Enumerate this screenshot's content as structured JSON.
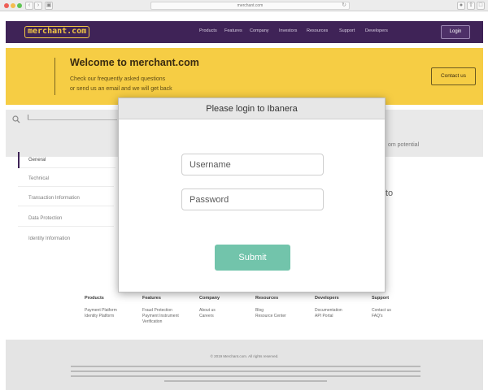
{
  "browser": {
    "url": "merchant.com",
    "back_glyph": "‹",
    "forward_glyph": "›",
    "sidebar_glyph": "▣",
    "reload_glyph": "↻",
    "right_icons": [
      "●",
      "⇧",
      "□"
    ]
  },
  "header": {
    "logo": "merchant.com",
    "nav": [
      "Products",
      "Features",
      "Company",
      "Investors",
      "Resources",
      "Support",
      "Developers"
    ],
    "login_label": "Login",
    "background_color": "#3f2357",
    "logo_color": "#f2c744"
  },
  "welcome": {
    "title": "Welcome to merchant.com",
    "line1": "Check our frequently asked questions",
    "line2": "or send us an email and we will get back",
    "contact_label": "Contact us",
    "background_color": "#f6cd44"
  },
  "background": {
    "partial_text_right": "om potential",
    "partial_text_to": "to"
  },
  "sidebar": {
    "items": [
      {
        "label": "General",
        "active": true
      },
      {
        "label": "Technical",
        "active": false
      },
      {
        "label": "Transaction Information",
        "active": false
      },
      {
        "label": "Data Protection",
        "active": false
      },
      {
        "label": "Identity Information",
        "active": false
      }
    ]
  },
  "footer": {
    "columns": [
      {
        "heading": "Products",
        "links": [
          "Payment Platform",
          "Identity Platform"
        ]
      },
      {
        "heading": "Features",
        "links": [
          "Fraud Protection",
          "Payment Instrument",
          "Verification"
        ]
      },
      {
        "heading": "Company",
        "links": [
          "About us",
          "Careers"
        ]
      },
      {
        "heading": "Resources",
        "links": [
          "Blog",
          "Resource Center"
        ]
      },
      {
        "heading": "Developers",
        "links": [
          "Documentation",
          "API Portal"
        ]
      },
      {
        "heading": "Support",
        "links": [
          "Contact us",
          "FAQ's"
        ]
      }
    ],
    "copyright": "© 2019 Merchant.com. All rights reserved."
  },
  "modal": {
    "title": "Please login to Ibanera",
    "username_placeholder": "Username",
    "password_placeholder": "Password",
    "submit_label": "Submit",
    "submit_color": "#72c4ab"
  }
}
